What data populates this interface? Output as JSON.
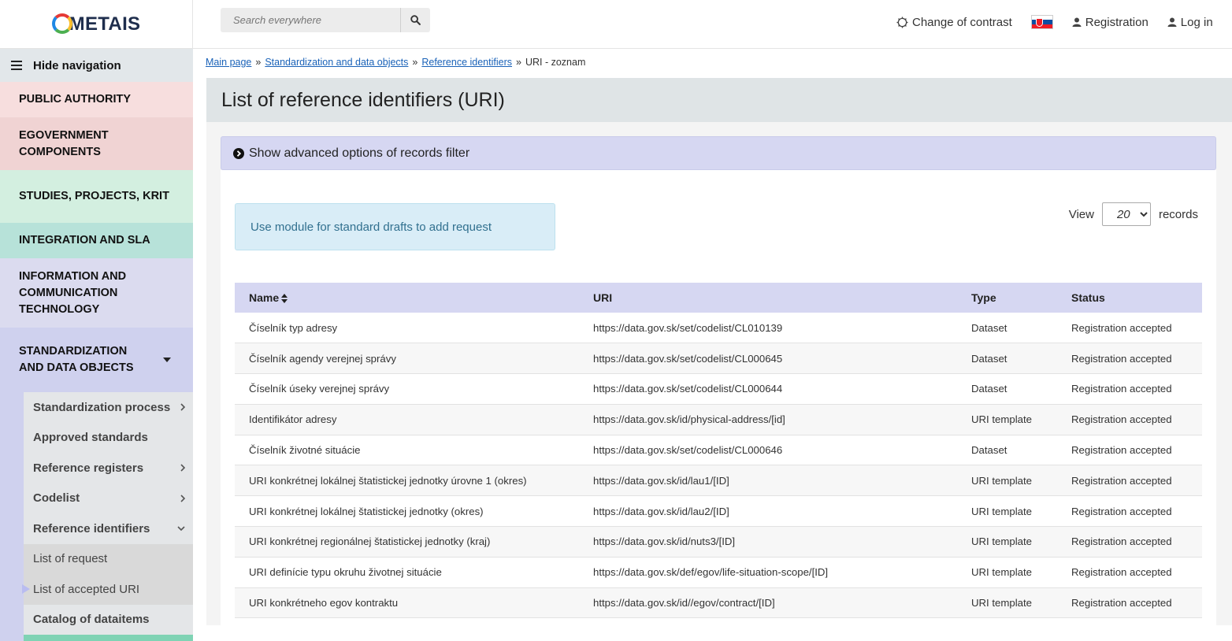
{
  "header": {
    "logo_text": "METAIS",
    "search": {
      "placeholder": "Search everywhere"
    },
    "change_contrast": "Change of contrast",
    "registration": "Registration",
    "login": "Log in"
  },
  "sidebar": {
    "hide_nav": "Hide navigation",
    "sections": [
      {
        "label": "PUBLIC AUTHORITY"
      },
      {
        "label": "EGOVERNMENT COMPONENTS"
      },
      {
        "label": "STUDIES, PROJECTS, KRIT"
      },
      {
        "label": "INTEGRATION AND SLA"
      },
      {
        "label": "INFORMATION AND COMMUNICATION TECHNOLOGY"
      },
      {
        "label": "STANDARDIZATION AND DATA OBJECTS"
      }
    ],
    "sub_items": [
      {
        "label": "Standardization process",
        "icon": ">"
      },
      {
        "label": "Approved standards",
        "icon": ""
      },
      {
        "label": "Reference registers",
        "icon": ">"
      },
      {
        "label": "Codelist",
        "icon": ">"
      },
      {
        "label": "Reference identifiers",
        "icon": "v"
      },
      {
        "label": "List of request"
      },
      {
        "label": "List of accepted URI"
      },
      {
        "label": "Catalog of dataitems"
      }
    ]
  },
  "breadcrumb": {
    "items": [
      "Main page",
      "Standardization and data objects",
      "Reference identifiers"
    ],
    "current": "URI - zoznam",
    "separator": "»"
  },
  "page": {
    "title": "List of reference identifiers (URI)",
    "filter_toggle": "Show advanced options of records filter",
    "info_message": "Use module for standard drafts to add request",
    "view_label": "View",
    "view_value": "20",
    "records_label": "records"
  },
  "table": {
    "columns": [
      "Name",
      "URI",
      "Type",
      "Status"
    ],
    "rows": [
      [
        "Číselník typ adresy",
        "https://data.gov.sk/set/codelist/CL010139",
        "Dataset",
        "Registration accepted"
      ],
      [
        "Číselník agendy verejnej správy",
        "https://data.gov.sk/set/codelist/CL000645",
        "Dataset",
        "Registration accepted"
      ],
      [
        "Číselník úseky verejnej správy",
        "https://data.gov.sk/set/codelist/CL000644",
        "Dataset",
        "Registration accepted"
      ],
      [
        "Identifikátor adresy",
        "https://data.gov.sk/id/physical-address/[id]",
        "URI template",
        "Registration accepted"
      ],
      [
        "Číselník životné situácie",
        "https://data.gov.sk/set/codelist/CL000646",
        "Dataset",
        "Registration accepted"
      ],
      [
        "URI konkrétnej lokálnej štatistickej jednotky úrovne 1 (okres)",
        "https://data.gov.sk/id/lau1/[ID]",
        "URI template",
        "Registration accepted"
      ],
      [
        "URI konkrétnej lokálnej štatistickej jednotky (okres)",
        "https://data.gov.sk/id/lau2/[ID]",
        "URI template",
        "Registration accepted"
      ],
      [
        "URI konkrétnej regionálnej štatistickej jednotky (kraj)",
        "https://data.gov.sk/id/nuts3/[ID]",
        "URI template",
        "Registration accepted"
      ],
      [
        "URI definície typu okruhu životnej situácie",
        "https://data.gov.sk/def/egov/life-situation-scope/[ID]",
        "URI template",
        "Registration accepted"
      ],
      [
        "URI konkrétneho egov kontraktu",
        "https://data.gov.sk/id//egov/contract/[ID]",
        "URI template",
        "Registration accepted"
      ]
    ]
  },
  "colors": {
    "accent_lavender": "#d6d7f2",
    "info_bg": "#d9edf7",
    "info_text": "#31708f",
    "link": "#1a62b8"
  }
}
